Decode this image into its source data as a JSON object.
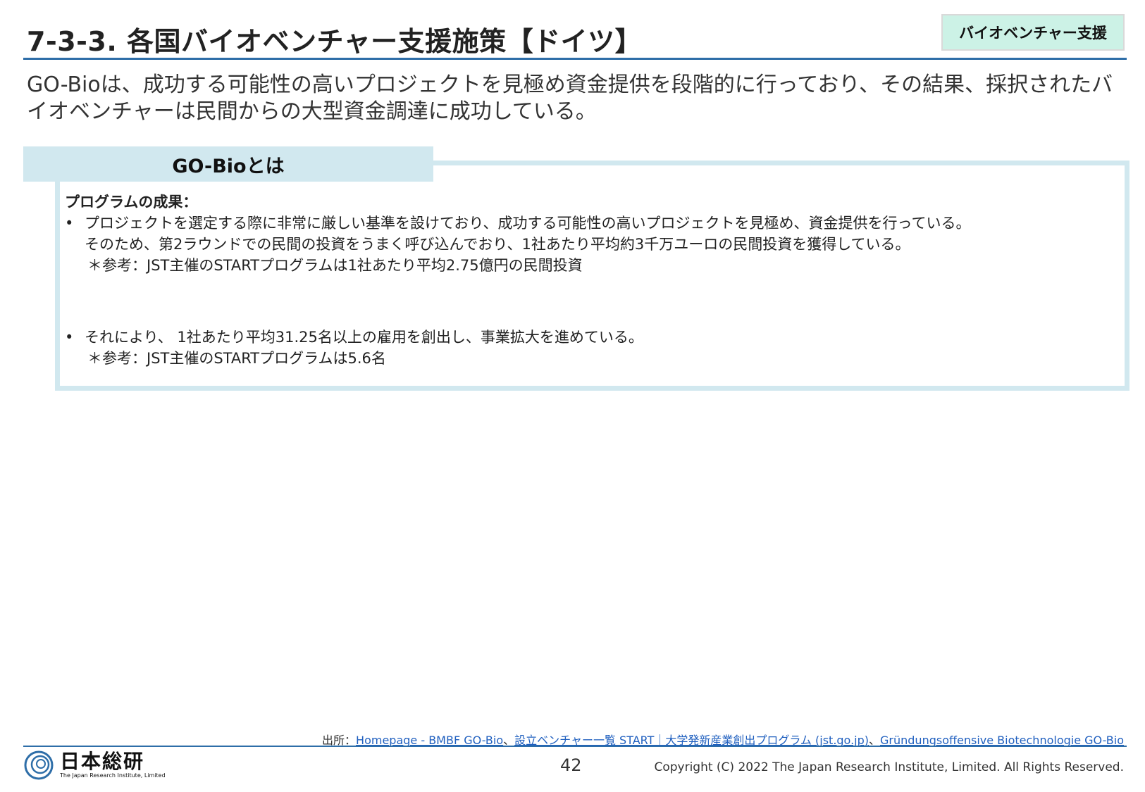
{
  "header": {
    "title": "7-3-3. 各国バイオベンチャー支援施策【ドイツ】",
    "tag": "バイオベンチャー支援"
  },
  "lead": "GO-Bioは、成功する可能性の高いプロジェクトを見極め資金提供を段階的に行っており、その結果、採択されたバイオベンチャーは民間からの大型資金調達に成功している。",
  "panel": {
    "header": "GO-Bioとは",
    "heading": "プログラムの成果：",
    "bullet_symbol": "•",
    "bullet1": {
      "line1": "プロジェクトを選定する際に非常に厳しい基準を設けており、成功する可能性の高いプロジェクトを見極め、資金提供を行っている。",
      "line2": "そのため、第2ラウンドでの民間の投資をうまく呼び込んでおり、1社あたり平均約3千万ユーロの民間投資を獲得している。",
      "note": "＊参考：JST主催のSTARTプログラムは1社あたり平均2.75億円の民間投資"
    },
    "bullet2": {
      "line1": "それにより、 1社あたり平均31.25名以上の雇用を創出し、事業拡大を進めている。",
      "note": "＊参考：JST主催のSTARTプログラムは5.6名"
    }
  },
  "footer": {
    "source_prefix": "出所：",
    "source_link1": "Homepage - BMBF GO-Bio",
    "sep1": "、",
    "source_link2": "設立ベンチャー一覧  START｜大学発新産業創出プログラム (jst.go.jp)",
    "sep2": "、",
    "source_link3": "Gründungsoffensive Biotechnologie GO-Bio",
    "page_number": "42",
    "copyright": "Copyright (C) 2022 The Japan Research Institute, Limited. All Rights Reserved.",
    "logo_name": "日本総研",
    "logo_sub": "The Japan Research Institute, Limited",
    "brand_color": "#2e6ea8"
  }
}
